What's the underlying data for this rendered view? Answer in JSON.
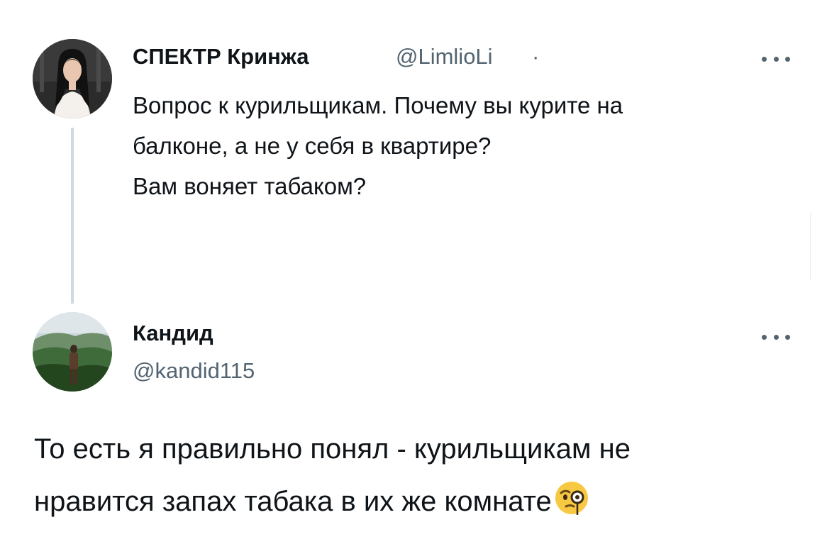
{
  "tweet_original": {
    "author_name": "СПЕКТР Кринжа",
    "author_handle": "@LimlioLi",
    "separator": "·",
    "text_lines": [
      "Вопрос к курильщикам. Почему вы курите на",
      "балконе, а не у себя в квартире?",
      "Вам воняет табаком?"
    ],
    "more_icon": "more-horizontal-icon"
  },
  "tweet_reply": {
    "author_name": "Кандид",
    "author_handle": "@kandid115",
    "text_lines": [
      "То есть я правильно понял - курильщикам не",
      "нравится запах табака в их же комнате"
    ],
    "emoji": "face-with-monocle",
    "more_icon": "more-horizontal-icon"
  },
  "colors": {
    "text_primary": "#0f1419",
    "text_secondary": "#536471",
    "thread_line": "#cfd9de",
    "background": "#ffffff"
  }
}
